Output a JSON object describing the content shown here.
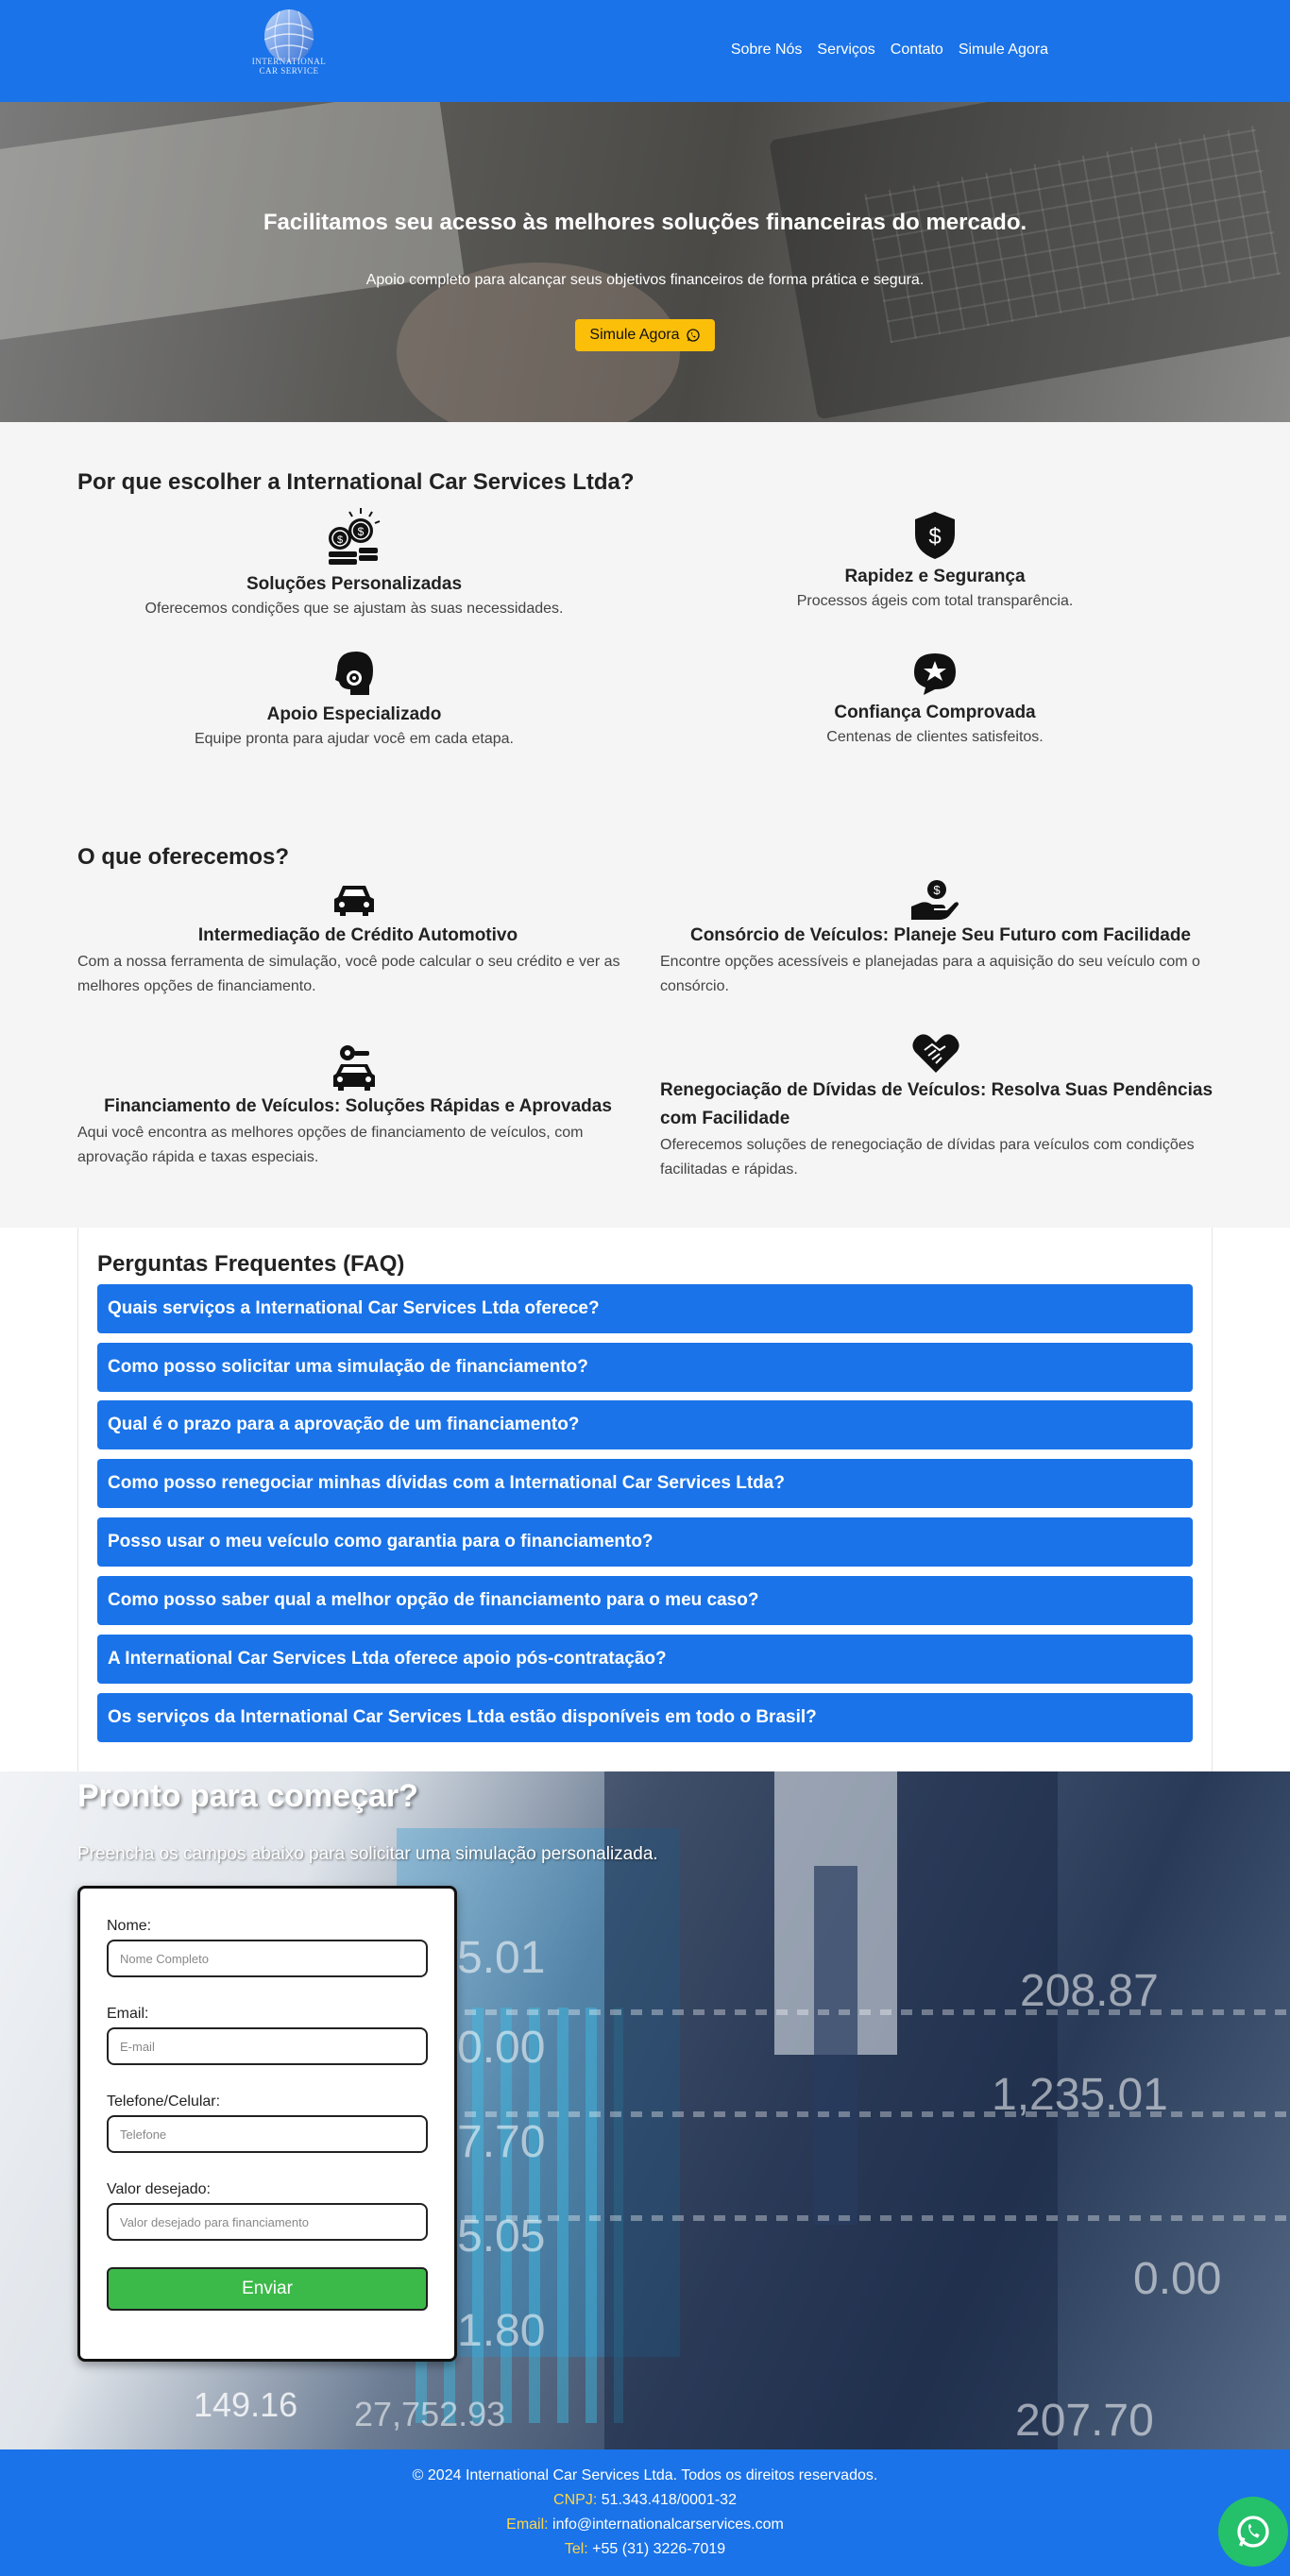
{
  "header": {
    "logo_text_line1": "INTERNATIONAL",
    "logo_text_line2": "CAR SERVICE",
    "nav": [
      "Sobre Nós",
      "Serviços",
      "Contato",
      "Simule Agora"
    ]
  },
  "hero": {
    "title": "Facilitamos seu acesso às melhores soluções financeiras do mercado.",
    "subtitle": "Apoio completo para alcançar seus objetivos financeiros de forma prática e segura.",
    "button": "Simule Agora"
  },
  "why": {
    "title": "Por que escolher a International Car Services Ltda?",
    "items": [
      {
        "title": "Soluções Personalizadas",
        "text": "Oferecemos condições que se ajustam às suas necessidades.",
        "icon": "coins-icon"
      },
      {
        "title": "Rapidez e Segurança",
        "text": "Processos ágeis com total transparência.",
        "icon": "shield-dollar-icon"
      },
      {
        "title": "Apoio Especializado",
        "text": "Equipe pronta para ajudar você em cada etapa.",
        "icon": "headset-icon"
      },
      {
        "title": "Confiança Comprovada",
        "text": "Centenas de clientes satisfeitos.",
        "icon": "star-badge-icon"
      }
    ]
  },
  "offers": {
    "title": "O que oferecemos?",
    "items": [
      {
        "title": "Intermediação de Crédito Automotivo",
        "text": "Com a nossa ferramenta de simulação, você pode calcular o seu crédito e ver as melhores opções de financiamento.",
        "icon": "car-icon"
      },
      {
        "title": "Consórcio de Veículos: Planeje Seu Futuro com Facilidade",
        "text": "Encontre opções acessíveis e planejadas para a aquisição do seu veículo com o consórcio.",
        "icon": "hand-coin-icon"
      },
      {
        "title": "Financiamento de Veículos: Soluções Rápidas e Aprovadas",
        "text": "Aqui você encontra as melhores opções de financiamento de veículos, com aprovação rápida e taxas especiais.",
        "icon": "car-key-icon"
      },
      {
        "title": "Renegociação de Dívidas de Veículos: Resolva Suas Pendências com Facilidade",
        "text": "Oferecemos soluções de renegociação de dívidas para veículos com condições facilitadas e rápidas.",
        "icon": "handshake-heart-icon"
      }
    ]
  },
  "faq": {
    "title": "Perguntas Frequentes (FAQ)",
    "questions": [
      "Quais serviços a International Car Services Ltda oferece?",
      "Como posso solicitar uma simulação de financiamento?",
      "Qual é o prazo para a aprovação de um financiamento?",
      "Como posso renegociar minhas dívidas com a International Car Services Ltda?",
      "Posso usar o meu veículo como garantia para o financiamento?",
      "Como posso saber qual a melhor opção de financiamento para o meu caso?",
      "A International Car Services Ltda oferece apoio pós-contratação?",
      "Os serviços da International Car Services Ltda estão disponíveis em todo o Brasil?"
    ]
  },
  "cta": {
    "title": "Pronto para começar?",
    "subtitle": "Preencha os campos abaixo para solicitar uma simulação personalizada.",
    "bg_numbers": [
      "5.01",
      "0.00",
      "7.70",
      "5.05",
      "1.80",
      "149.16",
      "27,752.93",
      "208.87",
      "1,235.01",
      "0.00",
      "207.70"
    ],
    "form": {
      "name_label": "Nome:",
      "name_placeholder": "Nome Completo",
      "email_label": "Email:",
      "email_placeholder": "E-mail",
      "phone_label": "Telefone/Celular:",
      "phone_placeholder": "Telefone",
      "value_label": "Valor desejado:",
      "value_placeholder": "Valor desejado para financiamento",
      "submit": "Enviar"
    }
  },
  "footer": {
    "copyright": "© 2024 International Car Services Ltda. Todos os direitos reservados.",
    "cnpj_label": "CNPJ:",
    "cnpj_value": "51.343.418/0001-32",
    "email_label": "Email:",
    "email_value": "info@internationalcarservices.com",
    "tel_label": "Tel:",
    "tel_value": "+55 (31) 3226-7019"
  },
  "colors": {
    "primary": "#1a73e8",
    "button_yellow": "#fbbf0a",
    "submit_green": "#3cba49",
    "whatsapp_green": "#25c06a"
  }
}
